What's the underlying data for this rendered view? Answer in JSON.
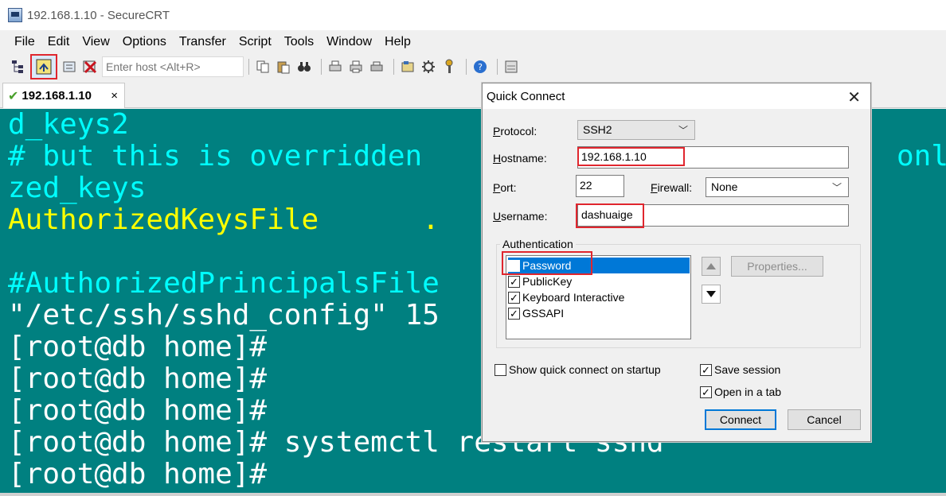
{
  "window": {
    "title": "192.168.1.10 - SecureCRT"
  },
  "menu": [
    "File",
    "Edit",
    "View",
    "Options",
    "Transfer",
    "Script",
    "Tools",
    "Window",
    "Help"
  ],
  "toolbar": {
    "host_placeholder": "Enter host <Alt+R>"
  },
  "tab": {
    "label": "192.168.1.10",
    "close": "×"
  },
  "terminal": {
    "lines": [
      {
        "text": "d_keys2",
        "color": "#00ffff"
      },
      {
        "text": "# but this is overridden",
        "color": "#00ffff"
      },
      {
        "text": "zed_keys",
        "color": "#00ffff"
      },
      {
        "text": "AuthorizedKeysFile      .",
        "color": "#ffff00"
      },
      {
        "text": "",
        "color": "#00ffff"
      },
      {
        "text": "#AuthorizedPrincipalsFile",
        "color": "#00ffff"
      },
      {
        "text": "\"/etc/ssh/sshd_config\" 15",
        "color": "#ffffff"
      },
      {
        "text": "[root@db home]#",
        "color": "#ffffff"
      },
      {
        "text": "[root@db home]#",
        "color": "#ffffff"
      },
      {
        "text": "[root@db home]#",
        "color": "#ffffff"
      },
      {
        "text": "[root@db home]# systemctl restart sshd",
        "color": "#ffffff"
      },
      {
        "text": "[root@db home]#",
        "color": "#ffffff"
      }
    ],
    "right_fragment": "onl"
  },
  "dialog": {
    "title": "Quick Connect",
    "close": "✕",
    "protocol_label": "Protocol:",
    "protocol_value": "SSH2",
    "hostname_label": "Hostname:",
    "hostname_value": "192.168.1.10",
    "port_label": "Port:",
    "port_value": "22",
    "firewall_label": "Firewall:",
    "firewall_value": "None",
    "username_label": "Username:",
    "username_value": "dashuaige",
    "auth_group_label": "Authentication",
    "auth_methods": [
      {
        "label": "Password",
        "checked": false,
        "selected": true
      },
      {
        "label": "PublicKey",
        "checked": true,
        "selected": false
      },
      {
        "label": "Keyboard Interactive",
        "checked": true,
        "selected": false
      },
      {
        "label": "GSSAPI",
        "checked": true,
        "selected": false
      }
    ],
    "properties_label": "Properties...",
    "show_on_startup_label": "Show quick connect on startup",
    "show_on_startup_checked": false,
    "save_session_label": "Save session",
    "save_session_checked": true,
    "open_in_tab_label": "Open in a tab",
    "open_in_tab_checked": true,
    "connect_label": "Connect",
    "cancel_label": "Cancel"
  }
}
